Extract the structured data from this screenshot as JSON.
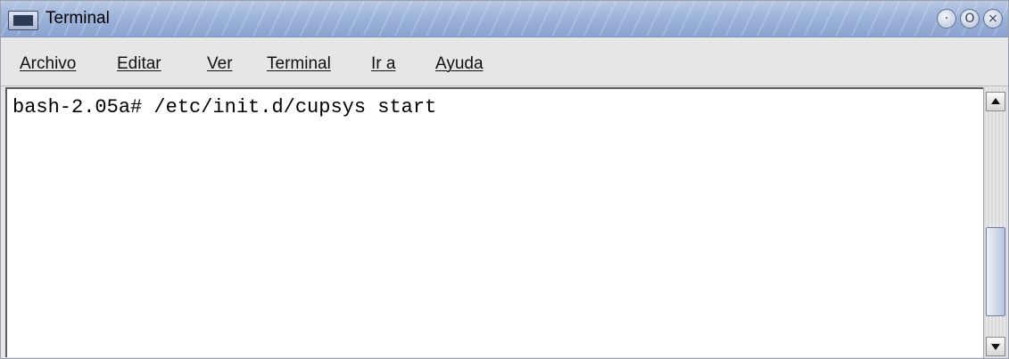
{
  "window": {
    "title": "Terminal",
    "icon": "terminal-icon",
    "controls": [
      {
        "name": "minimize-button",
        "glyph": "·"
      },
      {
        "name": "maximize-button",
        "glyph": "O"
      },
      {
        "name": "close-button",
        "glyph": "×"
      }
    ]
  },
  "menubar": {
    "items": [
      {
        "label": "Archivo"
      },
      {
        "label": "Editar"
      },
      {
        "label": "Ver"
      },
      {
        "label": "Terminal"
      },
      {
        "label": "Ir a"
      },
      {
        "label": "Ayuda"
      }
    ]
  },
  "terminal": {
    "lines": [
      "bash-2.05a# /etc/init.d/cupsys start"
    ]
  },
  "scrollbar": {
    "position": 0.86
  },
  "colors": {
    "titlebar": "#9db4da",
    "menubar": "#e6e6e6",
    "terminal_bg": "#ffffff",
    "terminal_fg": "#000000"
  }
}
